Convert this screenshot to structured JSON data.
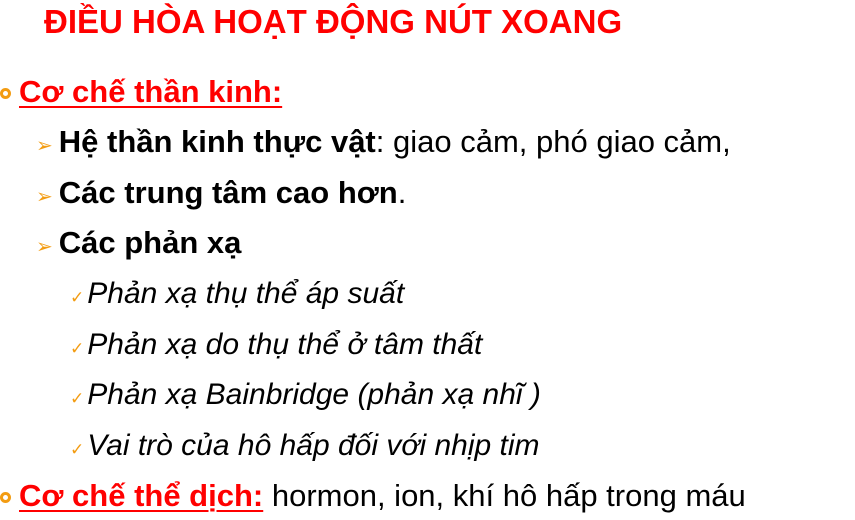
{
  "title": "ĐIỀU HÒA HOẠT ĐỘNG NÚT XOANG",
  "section1": {
    "heading": "Cơ chế thần kinh:",
    "items": [
      {
        "bold": "Hệ thần kinh thực vật",
        "rest": " : giao cảm, phó giao cảm,"
      },
      {
        "bold": "Các trung tâm cao hơn",
        "rest": "."
      },
      {
        "bold": "Các phản xạ",
        "rest": ""
      }
    ],
    "subitems": [
      "Phản xạ thụ thể áp suất",
      "Phản xạ do thụ thể ở tâm thất",
      "Phản xạ Bainbridge  (phản xạ nhĩ )",
      "Vai trò của hô hấp đối với nhịp tim"
    ]
  },
  "section2": {
    "heading": "Cơ chế thể dịch:",
    "text": " hormon, ion, khí hô hấp trong máu"
  },
  "colors": {
    "title": "#ff0000",
    "bullet": "#f39c12"
  },
  "icons": {
    "level1": "circle-bullet-icon",
    "level2": "arrow-bullet-icon",
    "level3": "check-bullet-icon"
  }
}
